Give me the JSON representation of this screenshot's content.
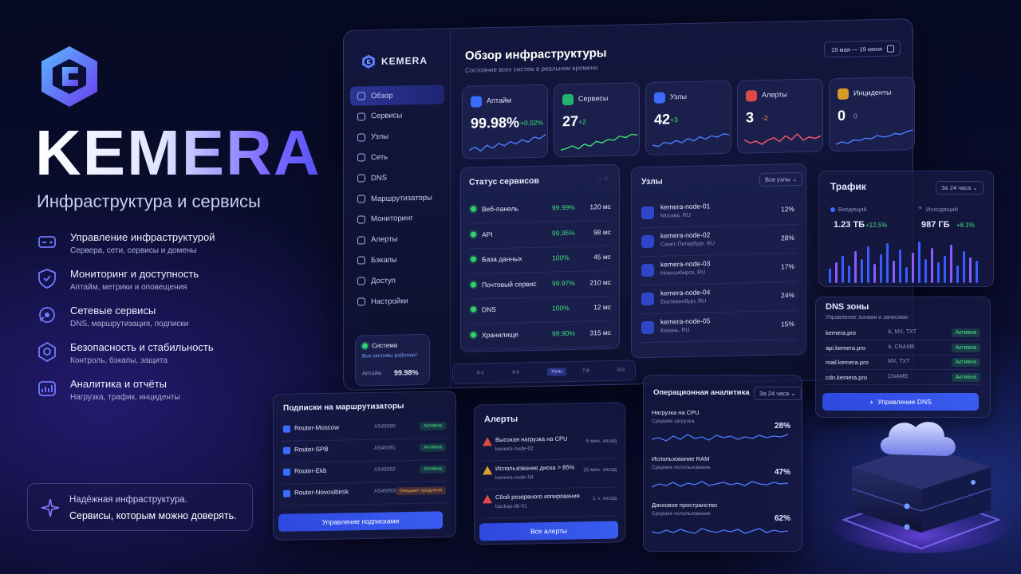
{
  "brand": {
    "name": "KEMERA",
    "tagline": "Инфраструктура и сервисы"
  },
  "features": [
    {
      "title": "Управление инфраструктурой",
      "sub": "Сервера, сети, сервисы и домены",
      "icon": "server-icon"
    },
    {
      "title": "Мониторинг и доступность",
      "sub": "Аптайм, метрики и оповещения",
      "icon": "shield-check-icon"
    },
    {
      "title": "Сетевые сервисы",
      "sub": "DNS, маршрутизация, подписки",
      "icon": "network-icon"
    },
    {
      "title": "Безопасность и стабильность",
      "sub": "Контроль, бэкапы, защита",
      "icon": "hexagon-shield-icon"
    },
    {
      "title": "Аналитика и отчёты",
      "sub": "Нагрузка, трафик, инциденты",
      "icon": "analytics-icon"
    }
  ],
  "promo": {
    "line1": "Надёжная инфраструктура.",
    "line2": "Сервисы, которым можно доверять."
  },
  "app": {
    "logo": "KEMERA",
    "title": "Обзор инфраструктуры",
    "subtitle": "Состояние всех систем в реальном времени",
    "date_range": "19 мая — 19 июня",
    "nav": [
      "Обзор",
      "Сервисы",
      "Узлы",
      "Сеть",
      "DNS",
      "Маршрутизаторы",
      "Мониторинг",
      "Алерты",
      "Бэкапы",
      "Доступ",
      "Настройки"
    ],
    "system": {
      "label": "Система",
      "status": "Все системы работают",
      "uptime_label": "Аптайм",
      "uptime": "99.98%"
    }
  },
  "kpis": [
    {
      "label": "Аптайм",
      "value": "99.98%",
      "delta": "+0.02%",
      "tone": "green",
      "color": "#3b6bff"
    },
    {
      "label": "Сервисы",
      "value": "27",
      "delta": "+2",
      "tone": "green",
      "color": "#24b36a"
    },
    {
      "label": "Узлы",
      "value": "42",
      "delta": "+3",
      "tone": "green",
      "color": "#3b6bff"
    },
    {
      "label": "Алерты",
      "value": "3",
      "delta": "-2",
      "tone": "orange",
      "color": "#e04848"
    },
    {
      "label": "Инциденты",
      "value": "0",
      "delta": "0",
      "tone": "muted",
      "color": "#d89a2a"
    }
  ],
  "services": {
    "title": "Статус сервисов",
    "rows": [
      {
        "name": "Веб-панель",
        "pct": "99.99%",
        "ms": "120 мс"
      },
      {
        "name": "API",
        "pct": "99.95%",
        "ms": "98 мс"
      },
      {
        "name": "База данных",
        "pct": "100%",
        "ms": "45 мс"
      },
      {
        "name": "Почтовый сервис",
        "pct": "99.97%",
        "ms": "210 мс"
      },
      {
        "name": "DNS",
        "pct": "100%",
        "ms": "12 мс"
      },
      {
        "name": "Хранилище",
        "pct": "99.90%",
        "ms": "315 мс"
      }
    ]
  },
  "nodes": {
    "title": "Узлы",
    "filter": "Все узлы",
    "rows": [
      {
        "name": "kemera-node-01",
        "city": "Москва, RU",
        "pct": "12%"
      },
      {
        "name": "kemera-node-02",
        "city": "Санкт-Петербург, RU",
        "pct": "28%"
      },
      {
        "name": "kemera-node-03",
        "city": "Новосибирск, RU",
        "pct": "17%"
      },
      {
        "name": "kemera-node-04",
        "city": "Екатеринбург, RU",
        "pct": "24%"
      },
      {
        "name": "kemera-node-05",
        "city": "Казань, RU",
        "pct": "15%"
      }
    ]
  },
  "traffic": {
    "title": "Трафик",
    "range": "За 24 часа",
    "in_label": "Входящий",
    "in_val": "1.23 ТБ",
    "in_delta": "+12.5%",
    "out_label": "Исходящий",
    "out_val": "987 ГБ",
    "out_delta": "+8.1%"
  },
  "dns": {
    "title": "DNS зоны",
    "subtitle": "Управление зонами и записями",
    "button": "Управление DNS",
    "rows": [
      {
        "zone": "kemera.pro",
        "rec": "A, MX, TXT",
        "status": "Активна"
      },
      {
        "zone": "api.kemera.pro",
        "rec": "A, CNAME",
        "status": "Активна"
      },
      {
        "zone": "mail.kemera.pro",
        "rec": "MX, TXT",
        "status": "Активна"
      },
      {
        "zone": "cdn.kemera.pro",
        "rec": "CNAME",
        "status": "Активна"
      }
    ]
  },
  "subs": {
    "title": "Подписки на маршрутизаторы",
    "button": "Управление подписками",
    "rows": [
      {
        "name": "Router-Moscow",
        "asn": "AS45090",
        "status": "Активна",
        "warn": false
      },
      {
        "name": "Router-SPB",
        "asn": "AS45091",
        "status": "Активна",
        "warn": false
      },
      {
        "name": "Router-Ekb",
        "asn": "AS45092",
        "status": "Активна",
        "warn": false
      },
      {
        "name": "Router-Novosibirsk",
        "asn": "AS45093",
        "status": "Ожидает продлени",
        "warn": true
      }
    ]
  },
  "alerts": {
    "title": "Алерты",
    "button": "Все алерты",
    "rows": [
      {
        "title": "Высокая нагрузка на CPU",
        "src": "kemera-node-02",
        "time": "5 мин. назад",
        "color": "#e04848"
      },
      {
        "title": "Использование диска > 85%",
        "src": "kemera-node-04",
        "time": "15 мин. назад",
        "color": "#e0a030"
      },
      {
        "title": "Сбой резервного копирования",
        "src": "backup-db-01",
        "time": "1 ч. назад",
        "color": "#e04848"
      }
    ]
  },
  "ops": {
    "title": "Операционная аналитика",
    "range": "За 24 часа",
    "rows": [
      {
        "title": "Нагрузка на CPU",
        "sub": "Средняя загрузка",
        "pct": "28%"
      },
      {
        "title": "Использование RAM",
        "sub": "Среднее использование",
        "pct": "47%"
      },
      {
        "title": "Дисковое пространство",
        "sub": "Среднее использование",
        "pct": "62%"
      }
    ]
  },
  "strip": [
    "0-1",
    "3-5",
    "Узлы",
    "7-8",
    "0-0"
  ]
}
